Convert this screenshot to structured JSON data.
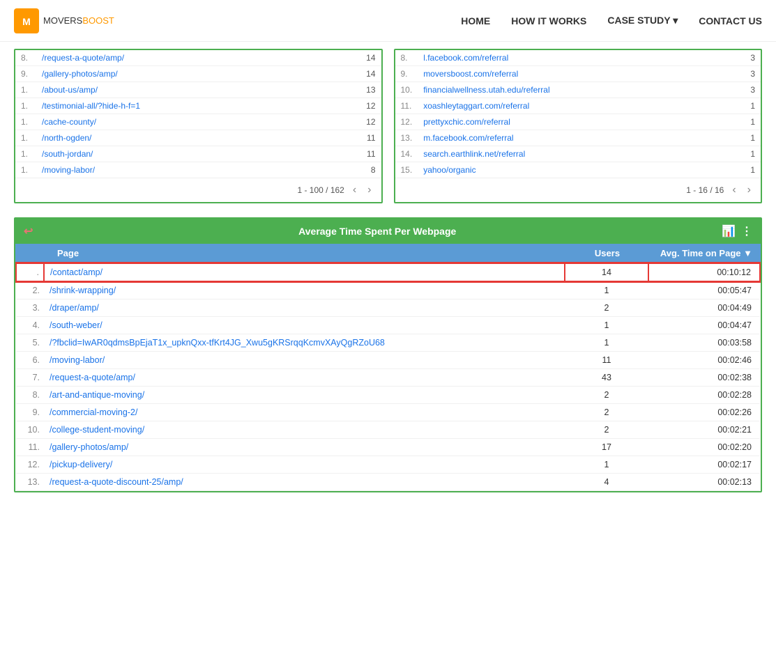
{
  "nav": {
    "logo_movers": "MOVERS",
    "logo_boost": "BOOST",
    "links": [
      {
        "id": "home",
        "label": "HOME"
      },
      {
        "id": "how-it-works",
        "label": "HOW IT WORKS"
      },
      {
        "id": "case-study",
        "label": "CASE STUDY ▾"
      },
      {
        "id": "contact-us",
        "label": "CONTACT US"
      }
    ]
  },
  "top_left_table": {
    "rows": [
      {
        "num": "8.",
        "page": "/request-a-quote/amp/",
        "val": "14"
      },
      {
        "num": "9.",
        "page": "/gallery-photos/amp/",
        "val": "14"
      },
      {
        "num": "1.",
        "page": "/about-us/amp/",
        "val": "13"
      },
      {
        "num": "1.",
        "page": "/testimonial-all/?hide-h-f=1",
        "val": "12"
      },
      {
        "num": "1.",
        "page": "/cache-county/",
        "val": "12"
      },
      {
        "num": "1.",
        "page": "/north-ogden/",
        "val": "11"
      },
      {
        "num": "1.",
        "page": "/south-jordan/",
        "val": "11"
      },
      {
        "num": "1.",
        "page": "/moving-labor/",
        "val": "8"
      }
    ],
    "pagination": "1 - 100 / 162"
  },
  "top_right_table": {
    "rows": [
      {
        "num": "8.",
        "page": "l.facebook.com/referral",
        "val": "3"
      },
      {
        "num": "9.",
        "page": "moversboost.com/referral",
        "val": "3"
      },
      {
        "num": "10.",
        "page": "financialwellness.utah.edu/referral",
        "val": "3"
      },
      {
        "num": "11.",
        "page": "xoashleytaggart.com/referral",
        "val": "1"
      },
      {
        "num": "12.",
        "page": "prettyxchic.com/referral",
        "val": "1"
      },
      {
        "num": "13.",
        "page": "m.facebook.com/referral",
        "val": "1"
      },
      {
        "num": "14.",
        "page": "search.earthlink.net/referral",
        "val": "1"
      },
      {
        "num": "15.",
        "page": "yahoo/organic",
        "val": "1"
      }
    ],
    "pagination": "1 - 16 / 16"
  },
  "avg_table": {
    "title": "Average Time Spent Per Webpage",
    "col_page": "Page",
    "col_users": "Users",
    "col_time": "Avg. Time on Page",
    "rows": [
      {
        "num": ".",
        "page": "/contact/amp/",
        "users": "14",
        "time": "00:10:12",
        "highlighted": true
      },
      {
        "num": "2.",
        "page": "/shrink-wrapping/",
        "users": "1",
        "time": "00:05:47",
        "highlighted": false
      },
      {
        "num": "3.",
        "page": "/draper/amp/",
        "users": "2",
        "time": "00:04:49",
        "highlighted": false
      },
      {
        "num": "4.",
        "page": "/south-weber/",
        "users": "1",
        "time": "00:04:47",
        "highlighted": false
      },
      {
        "num": "5.",
        "page": "/?fbclid=IwAR0qdmsBpEjaT1x_upknQxx-tfKrt4JG_Xwu5gKRSrqqKcmvXAyQgRZoU68",
        "users": "1",
        "time": "00:03:58",
        "highlighted": false
      },
      {
        "num": "6.",
        "page": "/moving-labor/",
        "users": "11",
        "time": "00:02:46",
        "highlighted": false
      },
      {
        "num": "7.",
        "page": "/request-a-quote/amp/",
        "users": "43",
        "time": "00:02:38",
        "highlighted": false
      },
      {
        "num": "8.",
        "page": "/art-and-antique-moving/",
        "users": "2",
        "time": "00:02:28",
        "highlighted": false
      },
      {
        "num": "9.",
        "page": "/commercial-moving-2/",
        "users": "2",
        "time": "00:02:26",
        "highlighted": false
      },
      {
        "num": "10.",
        "page": "/college-student-moving/",
        "users": "2",
        "time": "00:02:21",
        "highlighted": false
      },
      {
        "num": "11.",
        "page": "/gallery-photos/amp/",
        "users": "17",
        "time": "00:02:20",
        "highlighted": false
      },
      {
        "num": "12.",
        "page": "/pickup-delivery/",
        "users": "1",
        "time": "00:02:17",
        "highlighted": false
      },
      {
        "num": "13.",
        "page": "/request-a-quote-discount-25/amp/",
        "users": "4",
        "time": "00:02:13",
        "highlighted": false
      }
    ]
  },
  "icons": {
    "back": "↩",
    "chart": "📊",
    "menu": "⋮",
    "prev": "‹",
    "next": "›",
    "sort_down": "▼"
  }
}
